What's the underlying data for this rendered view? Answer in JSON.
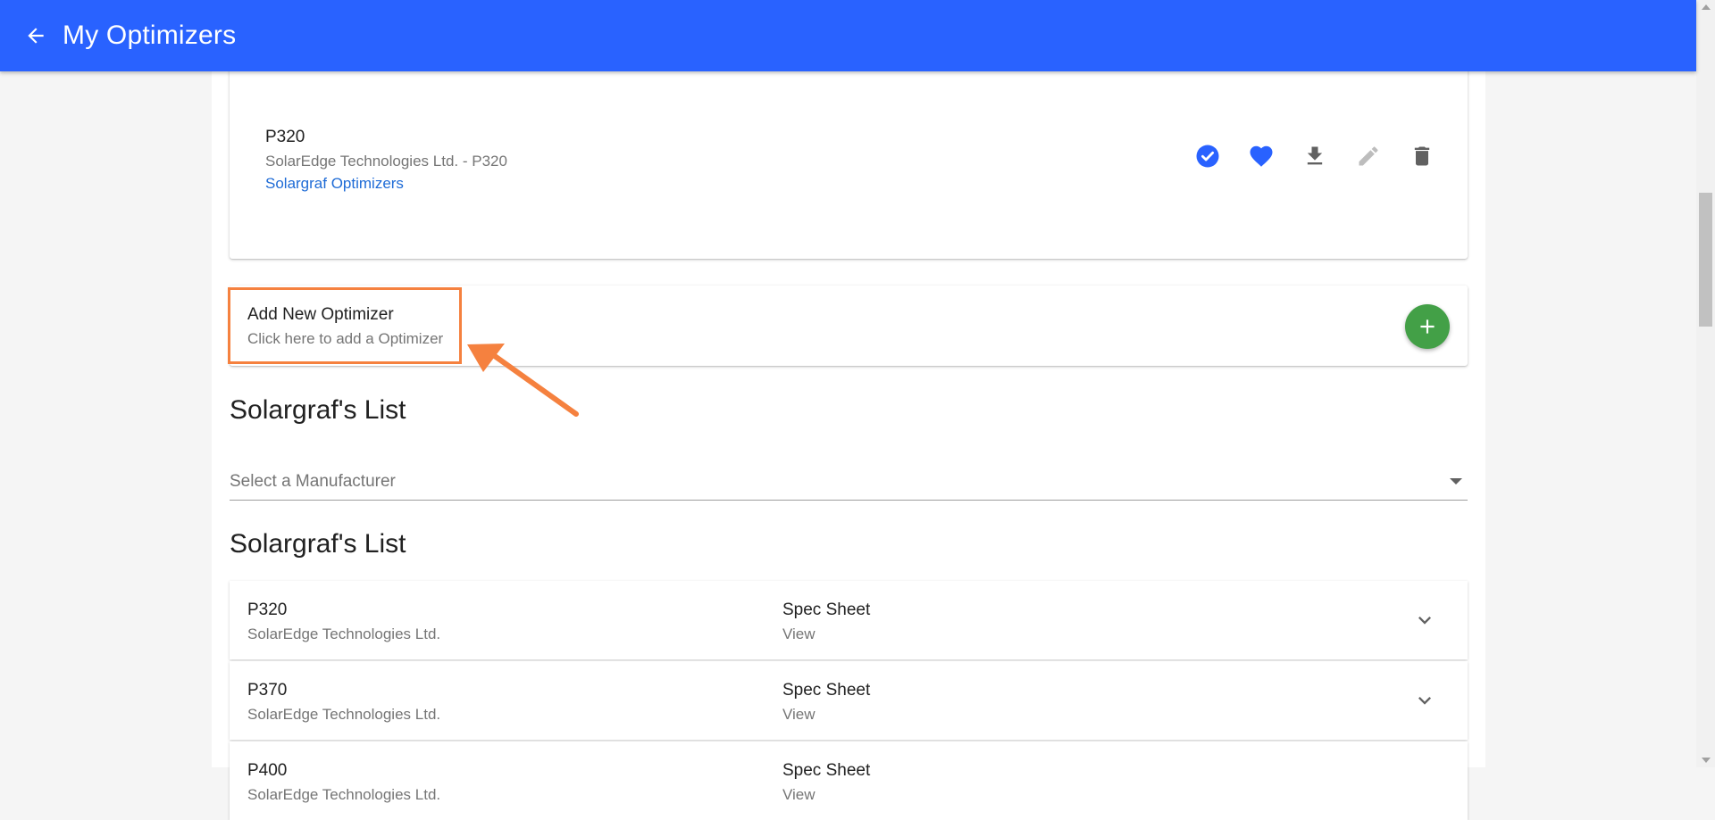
{
  "header": {
    "title": "My Optimizers",
    "back_icon": "arrow-back-icon",
    "color": "#2962ff"
  },
  "my_optimizer": {
    "name": "P320",
    "description": "SolarEdge Technologies Ltd. - P320",
    "source": "Solargraf Optimizers",
    "actions": [
      "check-circle-icon",
      "heart-icon",
      "download-icon",
      "edit-icon",
      "delete-icon"
    ]
  },
  "add_new": {
    "title": "Add New Optimizer",
    "subtitle": "Click here to add a Optimizer",
    "fab_icon": "plus-icon",
    "fab_color": "#43a047"
  },
  "annotation": {
    "color": "#f5813f"
  },
  "filter_section": {
    "title": "Solargraf's List",
    "select_placeholder": "Select a Manufacturer"
  },
  "list_section": {
    "title": "Solargraf's List",
    "rows": [
      {
        "name": "P320",
        "manufacturer": "SolarEdge Technologies Ltd.",
        "spec_label": "Spec Sheet",
        "spec_link": "View"
      },
      {
        "name": "P370",
        "manufacturer": "SolarEdge Technologies Ltd.",
        "spec_label": "Spec Sheet",
        "spec_link": "View"
      },
      {
        "name": "P400",
        "manufacturer": "SolarEdge Technologies Ltd.",
        "spec_label": "Spec Sheet",
        "spec_link": "View"
      }
    ]
  }
}
